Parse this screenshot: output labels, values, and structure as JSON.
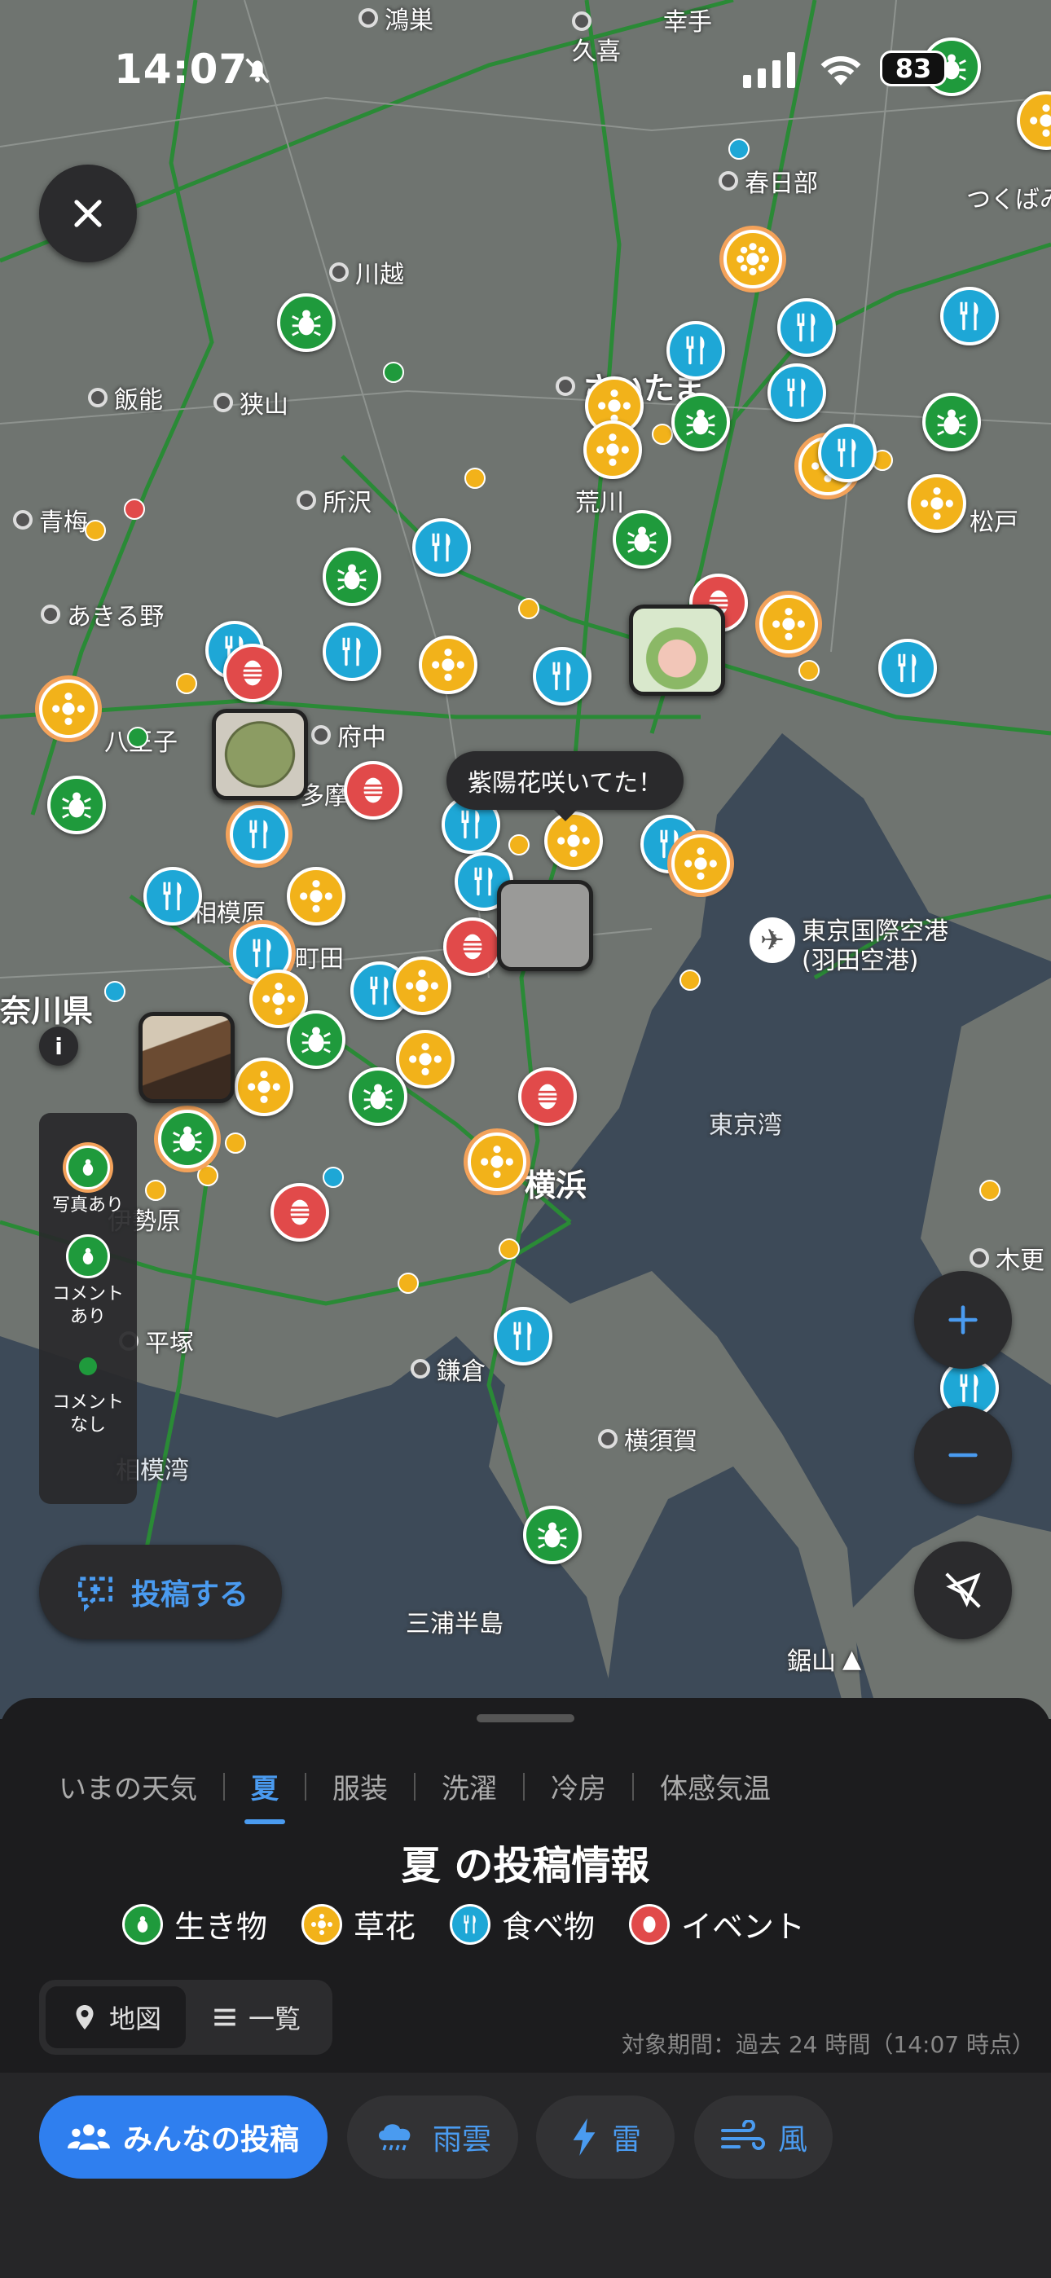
{
  "status": {
    "time": "14:07",
    "battery": "83"
  },
  "map": {
    "places": [
      {
        "name": "鴻巣"
      },
      {
        "name": "久喜"
      },
      {
        "name": "幸手"
      },
      {
        "name": "春日部"
      },
      {
        "name": "つくばみ"
      },
      {
        "name": "川越"
      },
      {
        "name": "飯能"
      },
      {
        "name": "狭山"
      },
      {
        "name": "さいたま"
      },
      {
        "name": "所沢"
      },
      {
        "name": "荒川"
      },
      {
        "name": "青梅"
      },
      {
        "name": "松戸"
      },
      {
        "name": "あきる野"
      },
      {
        "name": "八王子"
      },
      {
        "name": "府中"
      },
      {
        "name": "多摩"
      },
      {
        "name": "相模原"
      },
      {
        "name": "町田"
      },
      {
        "name": "奈川県"
      },
      {
        "name": "伊勢原"
      },
      {
        "name": "平塚"
      },
      {
        "name": "横浜"
      },
      {
        "name": "鎌倉"
      },
      {
        "name": "横須賀"
      },
      {
        "name": "三浦半島"
      },
      {
        "name": "相模湾"
      },
      {
        "name": "東京湾"
      },
      {
        "name": "木更"
      },
      {
        "name": "鋸山"
      },
      {
        "name": "東京国際空港\n(羽田空港)"
      }
    ],
    "bubble": "紫陽花咲いてた！",
    "info_icon": "info-icon"
  },
  "legend_side": {
    "photo": "写真あり",
    "comment": "コメント\nあり",
    "no_comment": "コメント\nなし"
  },
  "post_button": "投稿する",
  "sheet": {
    "tabs": [
      "いまの天気",
      "夏",
      "服装",
      "洗濯",
      "冷房",
      "体感気温"
    ],
    "active_tab": 1,
    "title": "夏 の投稿情報",
    "categories": [
      {
        "label": "生き物",
        "color": "#1f9a3c",
        "icon": "creature-icon"
      },
      {
        "label": "草花",
        "color": "#f2b21a",
        "icon": "flower-icon"
      },
      {
        "label": "食べ物",
        "color": "#1ea7d6",
        "icon": "food-icon"
      },
      {
        "label": "イベント",
        "color": "#e14a4a",
        "icon": "event-icon"
      }
    ],
    "view_map": "地図",
    "view_list": "一覧",
    "period": "対象期間：過去 24 時間（14:07 時点）"
  },
  "bottom_nav": [
    {
      "label": "みんなの投稿",
      "icon": "people-icon",
      "active": true
    },
    {
      "label": "雨雲",
      "icon": "rain-cloud-icon"
    },
    {
      "label": "雷",
      "icon": "lightning-icon"
    },
    {
      "label": "風",
      "icon": "wind-icon"
    }
  ]
}
